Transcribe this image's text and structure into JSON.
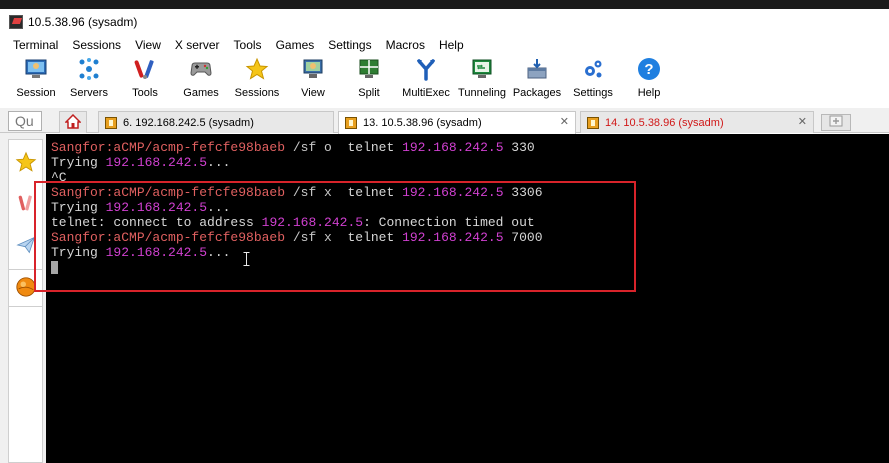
{
  "window": {
    "title": "10.5.38.96 (sysadm)"
  },
  "menu": [
    "Terminal",
    "Sessions",
    "View",
    "X server",
    "Tools",
    "Games",
    "Settings",
    "Macros",
    "Help"
  ],
  "toolbar": [
    {
      "label": "Session",
      "icon": "session-icon"
    },
    {
      "label": "Servers",
      "icon": "servers-icon"
    },
    {
      "label": "Tools",
      "icon": "tools-icon"
    },
    {
      "label": "Games",
      "icon": "games-icon"
    },
    {
      "label": "Sessions",
      "icon": "sessions-star-icon"
    },
    {
      "label": "View",
      "icon": "view-icon"
    },
    {
      "label": "Split",
      "icon": "split-icon"
    },
    {
      "label": "MultiExec",
      "icon": "multiexec-icon"
    },
    {
      "label": "Tunneling",
      "icon": "tunneling-icon"
    },
    {
      "label": "Packages",
      "icon": "packages-icon"
    },
    {
      "label": "Settings",
      "icon": "settings-gears-icon"
    },
    {
      "label": "Help",
      "icon": "help-icon"
    }
  ],
  "quick_connect": {
    "value": "Qu"
  },
  "tabs": [
    {
      "label": "6. 192.168.242.5 (sysadm)",
      "color": "#000000"
    },
    {
      "label": "13. 10.5.38.96 (sysadm)",
      "color": "#000000",
      "active": true
    },
    {
      "label": "14. 10.5.38.96 (sysadm)",
      "color": "#d01818"
    }
  ],
  "terminal_lines": [
    [
      {
        "t": "Sangfor:aCMP/acmp-fefcfe98baeb",
        "c": "prompt"
      },
      {
        "t": " /sf o  ",
        "c": "path"
      },
      {
        "t": "telnet ",
        "c": "text"
      },
      {
        "t": "192.168.242.5",
        "c": "ip"
      },
      {
        "t": " 330",
        "c": "text"
      }
    ],
    [
      {
        "t": "Trying ",
        "c": "text"
      },
      {
        "t": "192.168.242.5",
        "c": "ip"
      },
      {
        "t": "...",
        "c": "text"
      }
    ],
    [
      {
        "t": "^C",
        "c": "text"
      }
    ],
    [
      {
        "t": "Sangfor:aCMP/acmp-fefcfe98baeb",
        "c": "prompt"
      },
      {
        "t": " /sf x  ",
        "c": "path"
      },
      {
        "t": "telnet ",
        "c": "text"
      },
      {
        "t": "192.168.242.5",
        "c": "ip"
      },
      {
        "t": " 3306",
        "c": "text"
      }
    ],
    [
      {
        "t": "Trying ",
        "c": "text"
      },
      {
        "t": "192.168.242.5",
        "c": "ip"
      },
      {
        "t": "...",
        "c": "text"
      }
    ],
    [
      {
        "t": "telnet: connect to address ",
        "c": "text"
      },
      {
        "t": "192.168.242.5",
        "c": "ip"
      },
      {
        "t": ": Connection timed out",
        "c": "text"
      }
    ],
    [
      {
        "t": "Sangfor:aCMP/acmp-fefcfe98baeb",
        "c": "prompt"
      },
      {
        "t": " /sf x  ",
        "c": "path"
      },
      {
        "t": "telnet ",
        "c": "text"
      },
      {
        "t": "192.168.242.5",
        "c": "ip"
      },
      {
        "t": " 7000",
        "c": "text"
      }
    ],
    [
      {
        "t": "Trying ",
        "c": "text"
      },
      {
        "t": "192.168.242.5",
        "c": "ip"
      },
      {
        "t": "...",
        "c": "text"
      }
    ]
  ],
  "colors": {
    "prompt": "#e06060",
    "ip": "#d040d0",
    "terminal_bg": "#000000",
    "highlight": "#d8232a"
  }
}
